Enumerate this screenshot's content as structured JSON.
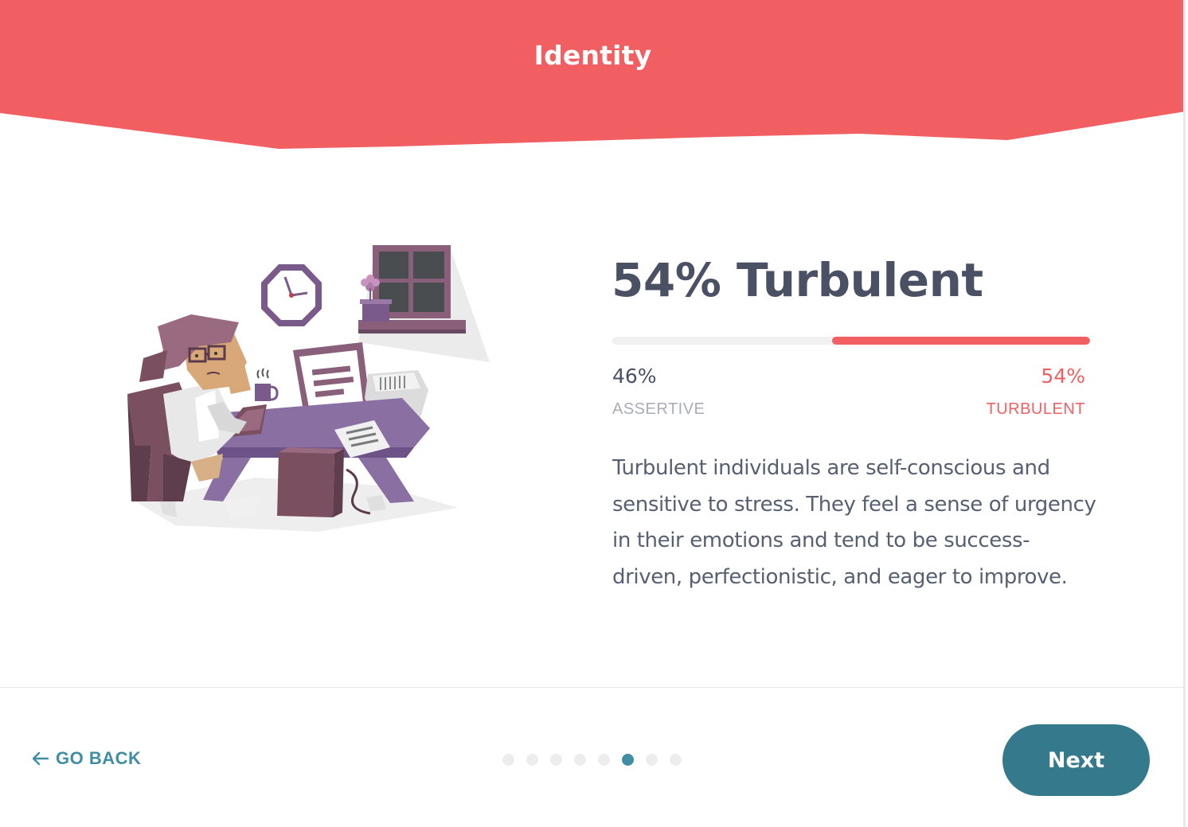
{
  "header": {
    "title": "Identity",
    "color": "#f25f62"
  },
  "result": {
    "title": "54% Turbulent",
    "turbulent_fraction": 0.54,
    "left_percent": "46%",
    "right_percent": "54%",
    "left_trait": "ASSERTIVE",
    "right_trait": "TURBULENT",
    "description": "Turbulent individuals are self-conscious and sensitive to stress. They feel a sense of urgency in their emotions and tend to be success-driven, perfectionistic, and eager to improve."
  },
  "illustration": {
    "icon": "stressed-person-at-desk-illustration"
  },
  "footer": {
    "go_back_label": "GO BACK",
    "next_label": "Next",
    "pagination": {
      "total": 8,
      "current": 6
    }
  },
  "colors": {
    "accent": "#f25f62",
    "teal": "#347a8c",
    "link": "#3f8ea3",
    "text": "#4b5164"
  }
}
